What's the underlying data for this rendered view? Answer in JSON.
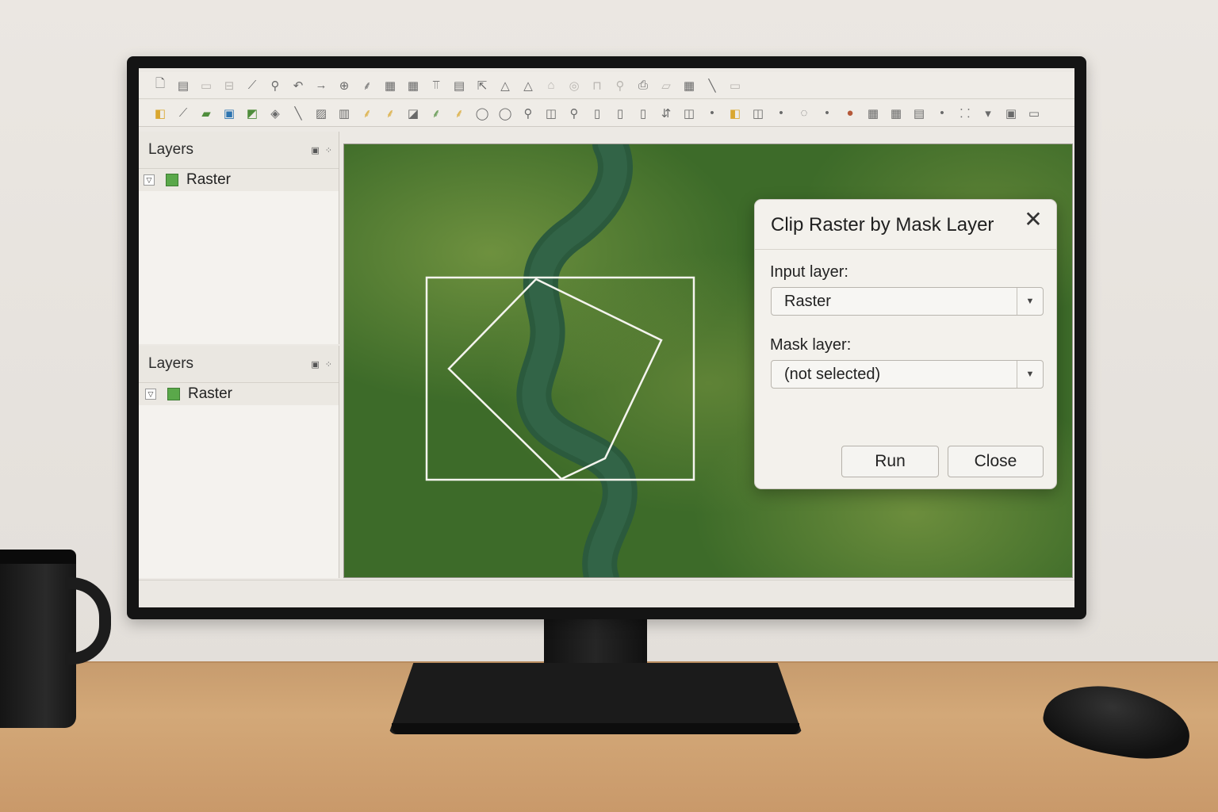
{
  "toolbar_row1": [
    {
      "icon": "new-project-icon",
      "glyph": "🗋"
    },
    {
      "icon": "open-icon",
      "glyph": "▤"
    },
    {
      "icon": "save-icon",
      "glyph": "▭"
    },
    {
      "icon": "layout-icon",
      "glyph": "⊟"
    },
    {
      "icon": "digitize-icon",
      "glyph": "⟋"
    },
    {
      "icon": "zoom-icon",
      "glyph": "⚲"
    },
    {
      "icon": "undo-icon",
      "glyph": "↶"
    },
    {
      "icon": "redo-icon",
      "glyph": "→"
    },
    {
      "icon": "pan-icon",
      "glyph": "⊕"
    },
    {
      "icon": "identify-icon",
      "glyph": "⸙"
    },
    {
      "icon": "table-icon",
      "glyph": "▦"
    },
    {
      "icon": "grid-icon",
      "glyph": "▦"
    },
    {
      "icon": "measure-icon",
      "glyph": "⫪"
    },
    {
      "icon": "attribute-table-icon",
      "glyph": "▤"
    },
    {
      "icon": "select-icon",
      "glyph": "⇱"
    },
    {
      "icon": "triangle-icon",
      "glyph": "△"
    },
    {
      "icon": "triangle-outline-icon",
      "glyph": "△"
    },
    {
      "icon": "home-icon",
      "glyph": "⌂"
    },
    {
      "icon": "circle-icon",
      "glyph": "◎"
    },
    {
      "icon": "bookmark-icon",
      "glyph": "⊓"
    },
    {
      "icon": "search-icon",
      "glyph": "⚲"
    },
    {
      "icon": "print-icon",
      "glyph": "⎙"
    },
    {
      "icon": "folder-icon",
      "glyph": "▱"
    },
    {
      "icon": "table-view-icon",
      "glyph": "▦"
    },
    {
      "icon": "line-icon",
      "glyph": "╲"
    },
    {
      "icon": "label-icon",
      "glyph": "▭"
    }
  ],
  "toolbar_row2": [
    {
      "icon": "add-layer-icon",
      "glyph": "◧"
    },
    {
      "icon": "edit-line-icon",
      "glyph": "⟋"
    },
    {
      "icon": "vector-layer-icon",
      "glyph": "▰"
    },
    {
      "icon": "raster-layer-icon",
      "glyph": "▣"
    },
    {
      "icon": "polygon-layer-icon",
      "glyph": "◩"
    },
    {
      "icon": "merge-icon",
      "glyph": "◈"
    },
    {
      "icon": "pencil-icon",
      "glyph": "╲"
    },
    {
      "icon": "image-icon",
      "glyph": "▨"
    },
    {
      "icon": "map-icon",
      "glyph": "▥"
    },
    {
      "icon": "python-icon",
      "glyph": "⸙"
    },
    {
      "icon": "plugin-icon",
      "glyph": "⸙"
    },
    {
      "icon": "document-icon",
      "glyph": "◪"
    },
    {
      "icon": "globe-icon",
      "glyph": "⸙"
    },
    {
      "icon": "globe-plugin-icon",
      "glyph": "⸙"
    },
    {
      "icon": "comment-icon",
      "glyph": "◯"
    },
    {
      "icon": "speech-icon",
      "glyph": "◯"
    },
    {
      "icon": "magnifier-icon",
      "glyph": "⚲"
    },
    {
      "icon": "layer-filter-icon",
      "glyph": "◫"
    },
    {
      "icon": "locate-icon",
      "glyph": "⚲"
    },
    {
      "icon": "column-icon",
      "glyph": "▯"
    },
    {
      "icon": "lock-icon",
      "glyph": "▯"
    },
    {
      "icon": "shape-icon",
      "glyph": "▯"
    },
    {
      "icon": "split-icon",
      "glyph": "⇵"
    },
    {
      "icon": "composer-icon",
      "glyph": "◫"
    },
    {
      "icon": "dot-icon",
      "glyph": "•"
    },
    {
      "icon": "style-icon",
      "glyph": "◧"
    },
    {
      "icon": "copy-icon",
      "glyph": "◫"
    },
    {
      "icon": "dot-small-icon",
      "glyph": "•"
    },
    {
      "icon": "sphere-icon",
      "glyph": "◌"
    },
    {
      "icon": "dot-tiny-icon",
      "glyph": "•"
    },
    {
      "icon": "shape-color-icon",
      "glyph": "●"
    },
    {
      "icon": "calculator-icon",
      "glyph": "▦"
    },
    {
      "icon": "spreadsheet-icon",
      "glyph": "▦"
    },
    {
      "icon": "chart-icon",
      "glyph": "▤"
    },
    {
      "icon": "dot-more-icon",
      "glyph": "•"
    },
    {
      "icon": "settings-dropdown-icon",
      "glyph": "⸬"
    },
    {
      "icon": "dropdown-arrow-icon",
      "glyph": "▾"
    },
    {
      "icon": "frame-icon",
      "glyph": "▣"
    },
    {
      "icon": "extra-icon",
      "glyph": "▭"
    }
  ],
  "layers_panels": [
    {
      "title": "Layers",
      "controls": "▣ ⁘",
      "layer": "Raster",
      "expanded": "▽"
    },
    {
      "title": "Layers",
      "controls": "▣ ⁘",
      "layer": "Raster",
      "expanded": "▽"
    }
  ],
  "dialog": {
    "title": "Clip Raster by Mask Layer",
    "close_glyph": "✕",
    "input_label": "Input layer:",
    "input_value": "Raster",
    "mask_label": "Mask layer:",
    "mask_value": "(not selected)",
    "dropdown_glyph": "▼",
    "run_label": "Run",
    "close_label": "Close"
  },
  "colors": {
    "forest": "#3f6e2a",
    "forest_light": "#6a8f3a",
    "river": "#2e5a3c",
    "layer_swatch": "#5aa84a"
  }
}
